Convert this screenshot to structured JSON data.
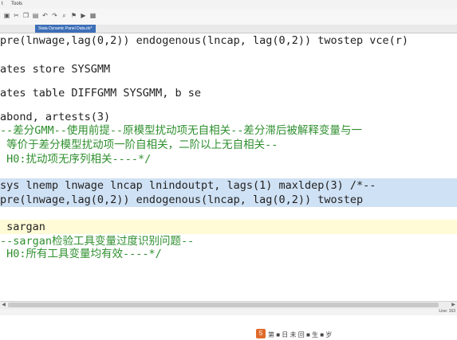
{
  "menubar": {
    "item1": "t",
    "item2": "Tools"
  },
  "toolbar": {
    "buttons": [
      "save-icon",
      "cut-icon",
      "copy-icon",
      "paste-icon",
      "undo-icon",
      "redo-icon",
      "find-icon",
      "bookmark-icon",
      "run-icon",
      "do-icon"
    ]
  },
  "tab": {
    "label": "Stata Dynamic Panel Data.do*"
  },
  "editor": {
    "lines": [
      "pre(lnwage,lag(0,2)) endogenous(lncap, lag(0,2)) twostep vce(r)",
      "",
      "ates store SYSGMM",
      "",
      "ates table DIFFGMM SYSGMM, b se",
      "",
      "abond, artests(3)",
      "--差分GMM--使用前提--原模型扰动项无自相关--差分滞后被解释变量与一",
      " 等价于差分模型扰动项一阶自相关，二阶以上无自相关--",
      " H0:扰动项无序列相关----*/",
      "",
      "sys lnemp lnwage lncap lnindoutpt, lags(1) maxldep(3) /*--",
      "pre(lnwage,lag(0,2)) endogenous(lncap, lag(0,2)) twostep",
      "",
      " sargan",
      "--sargan检验工具变量过度识别问题--",
      " H0:所有工具变量均有效----*/"
    ]
  },
  "statusbar": {
    "position": "Line: 163"
  },
  "watermark": {
    "text": "第 ■ 日 未 回 ■ 生 ■ 岁"
  },
  "colors": {
    "code": "#222222",
    "comment": "#2f8f2f",
    "selection": "#cfe1f4",
    "current_line": "#fffbd6",
    "tab": "#3d6fb8"
  }
}
